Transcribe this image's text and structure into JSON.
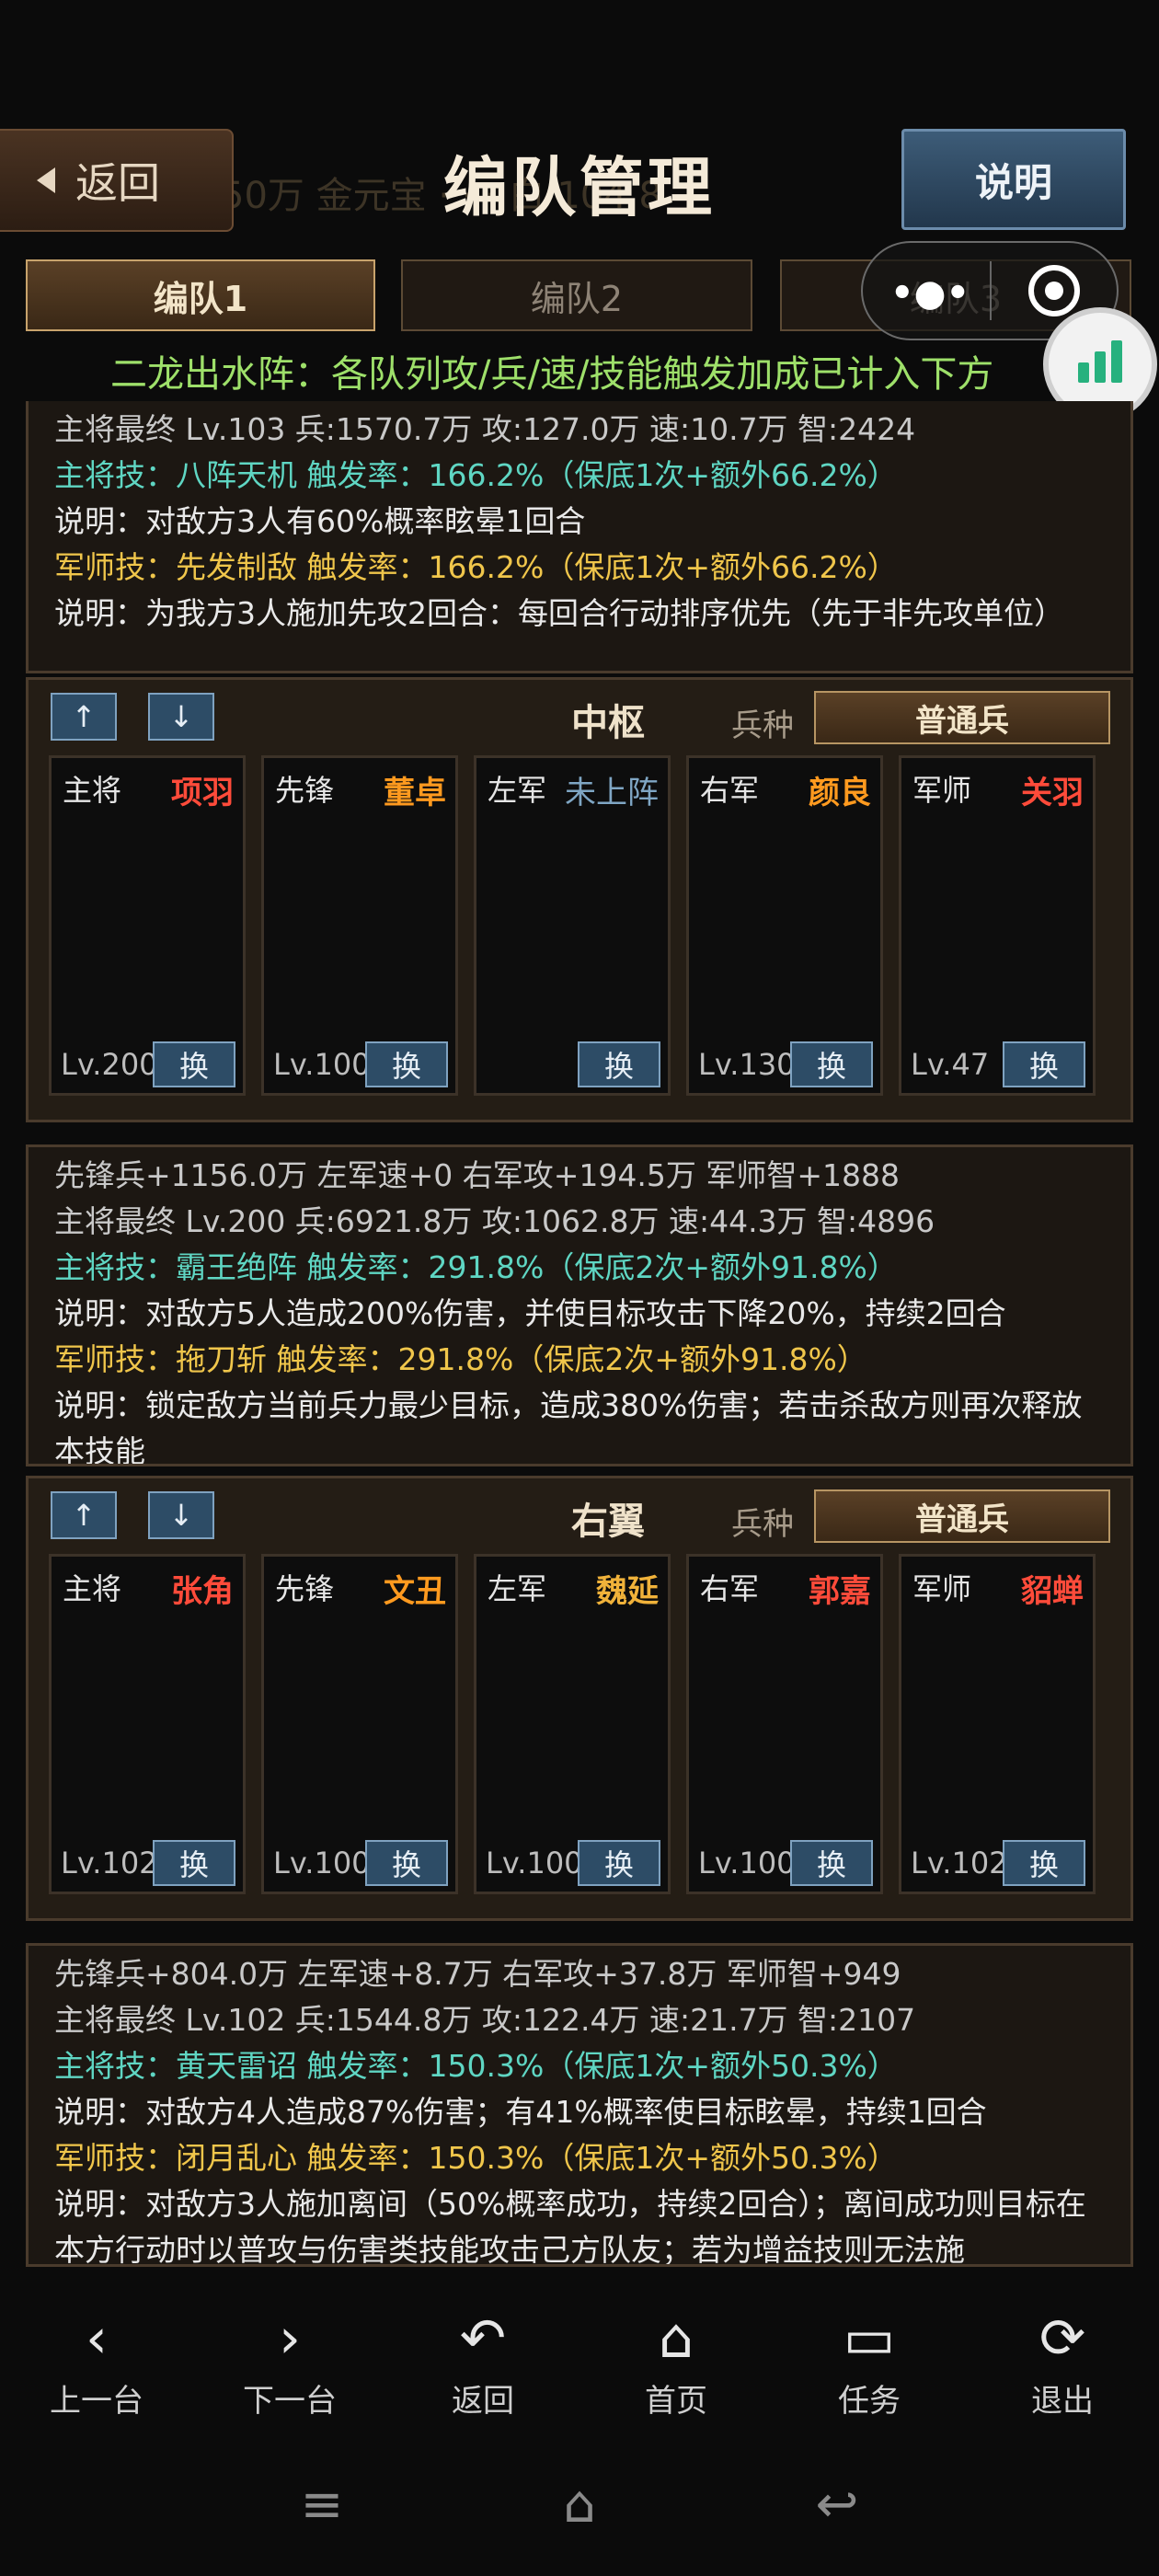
{
  "header": {
    "back_label": "返回",
    "title": "编队管理",
    "help_label": "说明",
    "faint_text": "50万  金元宝  ·  ·  ·  白 104.8"
  },
  "tabs": [
    {
      "label": "编队1",
      "active": true
    },
    {
      "label": "编队2",
      "active": false
    },
    {
      "label": "编队3",
      "active": false
    }
  ],
  "banner": "二龙出水阵：各队列攻/兵/速/技能触发加成已计入下方",
  "panel_top": {
    "lines": [
      "主将最终 Lv.103 兵:1570.7万 攻:127.0万 速:10.7万 智:2424",
      "主将技：八阵天机 触发率：166.2%（保底1次+额外66.2%）",
      "说明：对敌方3人有60%概率眩晕1回合",
      "军师技：先发制敌 触发率：166.2%（保底1次+额外66.2%）",
      "说明：为我方3人施加先攻2回合：每回合行动排序优先（先于非先攻单位）"
    ]
  },
  "squad_center": {
    "up": "↑",
    "down": "↓",
    "title": "中枢",
    "troop_label": "兵种",
    "troop_value": "普通兵",
    "slots": [
      {
        "role": "主将",
        "name": "项羽",
        "color": "#ff4b3a",
        "lv": "Lv.200",
        "swap": "换"
      },
      {
        "role": "先锋",
        "name": "董卓",
        "color": "#ff9a1f",
        "lv": "Lv.100",
        "swap": "换"
      },
      {
        "role": "左军",
        "name": "未上阵",
        "color": "#7fa6c4",
        "lv": "",
        "swap": "换"
      },
      {
        "role": "右军",
        "name": "颜良",
        "color": "#ff9a1f",
        "lv": "Lv.130",
        "swap": "换"
      },
      {
        "role": "军师",
        "name": "关羽",
        "color": "#ff4b3a",
        "lv": "Lv.47",
        "swap": "换"
      }
    ]
  },
  "panel_mid": {
    "lines": [
      "先锋兵+1156.0万  左军速+0  右军攻+194.5万  军师智+1888",
      "主将最终 Lv.200 兵:6921.8万 攻:1062.8万 速:44.3万 智:4896",
      "主将技：霸王绝阵 触发率：291.8%（保底2次+额外91.8%）",
      "说明：对敌方5人造成200%伤害，并使目标攻击下降20%，持续2回合",
      "军师技：拖刀斩 触发率：291.8%（保底2次+额外91.8%）",
      "说明：锁定敌方当前兵力最少目标，造成380%伤害；若击杀敌方则再次释放本技能"
    ]
  },
  "squad_right": {
    "up": "↑",
    "down": "↓",
    "title": "右翼",
    "troop_label": "兵种",
    "troop_value": "普通兵",
    "slots": [
      {
        "role": "主将",
        "name": "张角",
        "color": "#ff4b3a",
        "lv": "Lv.102",
        "swap": "换"
      },
      {
        "role": "先锋",
        "name": "文丑",
        "color": "#ff9a1f",
        "lv": "Lv.100",
        "swap": "换"
      },
      {
        "role": "左军",
        "name": "魏延",
        "color": "#f0b23a",
        "lv": "Lv.100",
        "swap": "换"
      },
      {
        "role": "右军",
        "name": "郭嘉",
        "color": "#ff4b3a",
        "lv": "Lv.100",
        "swap": "换"
      },
      {
        "role": "军师",
        "name": "貂蝉",
        "color": "#ff4b3a",
        "lv": "Lv.102",
        "swap": "换"
      }
    ]
  },
  "panel_bottom": {
    "lines": [
      "先锋兵+804.0万  左军速+8.7万  右军攻+37.8万  军师智+949",
      "主将最终 Lv.102 兵:1544.8万 攻:122.4万 速:21.7万 智:2107",
      "主将技：黄天雷诏 触发率：150.3%（保底1次+额外50.3%）",
      "说明：对敌方4人造成87%伤害；有41%概率使目标眩晕，持续1回合",
      "军师技：闭月乱心 触发率：150.3%（保底1次+额外50.3%）",
      "说明：对敌方3人施加离间（50%概率成功，持续2回合）；离间成功则目标在本方行动时以普攻与伤害类技能攻击己方队友；若为增益技则无法施"
    ]
  },
  "nav": [
    {
      "icon": "‹",
      "label": "上一台"
    },
    {
      "icon": "›",
      "label": "下一台"
    },
    {
      "icon": "↶",
      "label": "返回"
    },
    {
      "icon": "⌂",
      "label": "首页"
    },
    {
      "icon": "▭",
      "label": "任务"
    },
    {
      "icon": "⟳",
      "label": "退出"
    }
  ],
  "system_bar": {
    "menu": "≡",
    "home": "⌂",
    "back": "↩"
  }
}
